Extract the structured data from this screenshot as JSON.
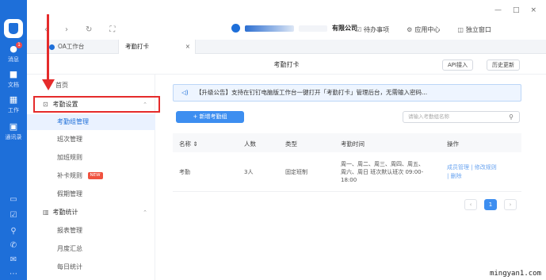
{
  "rail": {
    "items": [
      {
        "label": "消息",
        "badge": "1"
      },
      {
        "label": "文档"
      },
      {
        "label": "工作"
      },
      {
        "label": "通讯录"
      }
    ]
  },
  "window": {
    "minimize": "—",
    "maximize": "□",
    "close": "×"
  },
  "toolbar": {
    "company_suffix": "有限公司",
    "company_caret": "⌄",
    "todo": "待办事项",
    "apps": "应用中心",
    "standalone": "独立窗口"
  },
  "tabs": [
    {
      "label": "OA工作台"
    },
    {
      "label": "考勤打卡",
      "close": "×"
    }
  ],
  "page": {
    "title": "考勤打卡",
    "api_button": "API接入",
    "history_button": "历史更新"
  },
  "menu": {
    "home": "首页",
    "group1": "考勤设置",
    "group1_items": [
      "考勤组管理",
      "班次管理",
      "加班规则",
      "补卡规则",
      "假期管理"
    ],
    "new_tag": "NEW",
    "group2": "考勤统计",
    "group2_items": [
      "报表管理",
      "月度汇总",
      "每日统计"
    ]
  },
  "notice": {
    "text": "【升级公告】支持在钉钉电脑版工作台一键打开「考勤打卡」管理后台，无需输入密码..."
  },
  "actions": {
    "add_group": "+ 新增考勤组",
    "search_placeholder": "请输入考勤组名称"
  },
  "table": {
    "headers": [
      "名称 ⇕",
      "人数",
      "类型",
      "考勤时间",
      "操作"
    ],
    "rows": [
      {
        "name": "考勤",
        "count": "3人",
        "type": "固定班制",
        "time": "周一、周二、周三、周四、周五、周六、周日  班次默认班次 09:00-18:00",
        "op1": "成员管理 | 修改规则",
        "op2": "| 删除"
      }
    ]
  },
  "pager": {
    "prev": "‹",
    "current": "1",
    "next": "›"
  },
  "watermark": "mingyan1.com"
}
